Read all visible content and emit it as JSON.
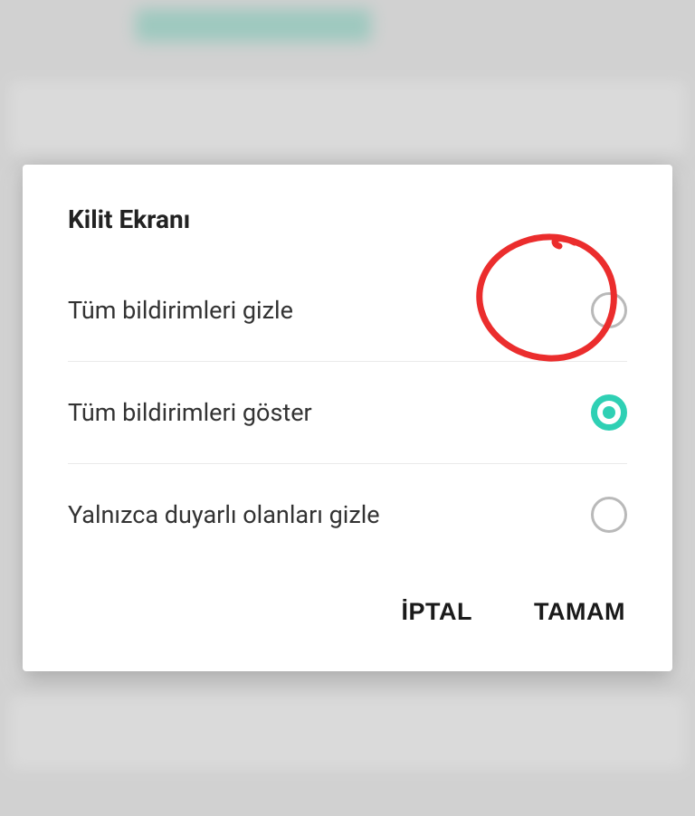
{
  "dialog": {
    "title": "Kilit Ekranı",
    "options": [
      {
        "label": "Tüm bildirimleri gizle",
        "selected": false
      },
      {
        "label": "Tüm bildirimleri göster",
        "selected": true
      },
      {
        "label": "Yalnızca duyarlı olanları gizle",
        "selected": false
      }
    ],
    "cancel_label": "İPTAL",
    "confirm_label": "TAMAM"
  },
  "colors": {
    "accent": "#2fd0b4",
    "annotation": "#eb2d2d"
  }
}
